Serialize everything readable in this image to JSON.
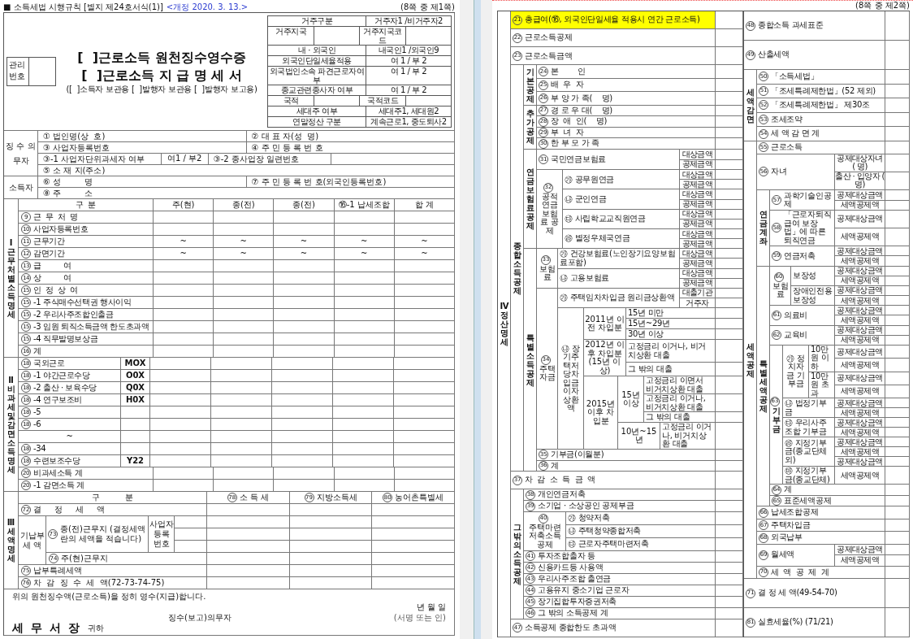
{
  "left_page": {
    "form_id": "■ 소득세법 시행규칙 [별지 제24호서식(1)]",
    "revision": "<개정 2020. 3. 13.>",
    "page_no": "(8쪽 중 제1쪽)",
    "management_label": "관리번호",
    "titles": [
      "[  ]근로소득 원천징수영수증",
      "[  ]근로소득 지 급 명 세 서"
    ],
    "copies": "([  ]소득자 보관용 [  ]발행자 보관용 [  ]발행자 보고용)",
    "info_rows": [
      {
        "kind": "pair",
        "cells": [
          "거주구분",
          "거주자1 /비거주자2"
        ]
      },
      {
        "kind": "blanks",
        "cells": [
          "거주지국",
          "거주지국코드"
        ]
      },
      {
        "kind": "pair",
        "cells": [
          "내 · 외국인",
          "내국인1 /외국인9"
        ]
      },
      {
        "kind": "pair",
        "cells": [
          "외국인단일세율적용",
          "여 1 / 부 2"
        ]
      },
      {
        "kind": "pair",
        "cells": [
          "외국법인소속 파견근로자여부",
          "여 1 / 부 2"
        ]
      },
      {
        "kind": "pair",
        "cells": [
          "종교관련종사자 여부",
          "여 1 / 부 2"
        ]
      },
      {
        "kind": "blanks",
        "cells": [
          "국적",
          "국적코드"
        ]
      },
      {
        "kind": "pair",
        "cells": [
          "세대주 여부",
          "세대주1, 세대원2"
        ]
      },
      {
        "kind": "pair",
        "cells": [
          "연말정산 구분",
          "계속근로1, 중도퇴사2"
        ]
      }
    ],
    "parties": [
      {
        "label": "징 수 의무자",
        "rows": [
          [
            {
              "kind": "label",
              "text": "① 법인명(상  호)"
            },
            {
              "kind": "label",
              "text": "② 대 표 자(성  명)"
            }
          ],
          [
            {
              "kind": "label",
              "text": "③ 사업자등록번호"
            },
            {
              "kind": "label",
              "text": "④ 주 민 등 록 번 호"
            }
          ],
          [
            {
              "kind": "label",
              "text": "③-1 사업자단위과세자 여부"
            },
            {
              "kind": "option",
              "text": "여1 / 부2"
            },
            {
              "kind": "label",
              "text": "③-2 종사업장 일련번호"
            }
          ],
          [
            {
              "kind": "label",
              "text": "⑤ 소 재 지(주소)"
            }
          ]
        ]
      },
      {
        "label": "소득자",
        "rows": [
          [
            {
              "kind": "label",
              "text": "⑥ 성         명"
            },
            {
              "kind": "label",
              "text": "⑦ 주 민 등 록 번 호(외국인등록번호)"
            }
          ],
          [
            {
              "kind": "label",
              "text": "⑧ 주         소"
            }
          ]
        ]
      }
    ],
    "income": {
      "side": "Ⅰ근무처별소득명세",
      "columns": [
        "구  분",
        "주(현)",
        "종(전)",
        "종(전)",
        "⑯-1 납세조합",
        "합  계"
      ],
      "rows": [
        {
          "num": "9",
          "label": "근  무  처  명"
        },
        {
          "num": "10",
          "label": "사업자등록번호"
        },
        {
          "num": "11",
          "label": "근무기간",
          "cells": [
            "~",
            "~",
            "~",
            "~",
            "~"
          ]
        },
        {
          "num": "12",
          "label": "감면기간",
          "cells": [
            "~",
            "~",
            "~",
            "~",
            "~"
          ]
        },
        {
          "num": "13",
          "label": "급          여"
        },
        {
          "num": "14",
          "label": "상          여"
        },
        {
          "num": "15",
          "label": "인  정  상  여"
        },
        {
          "num": "15",
          "label": "-1 주식매수선택권 행사이익"
        },
        {
          "num": "15",
          "label": "-2 우리사주조합인출금"
        },
        {
          "num": "15",
          "label": "-3 임원 퇴직소득금액 한도초과액"
        },
        {
          "num": "15",
          "label": "-4 직무발명보상금"
        },
        {
          "num": "16",
          "label": "계"
        }
      ]
    },
    "nontax": {
      "side": "Ⅱ비과세및감면소득명세",
      "rows": [
        {
          "kind": "item",
          "num": "18",
          "label": "국외근로",
          "code": "MOX"
        },
        {
          "kind": "item",
          "num": "18",
          "label": "-1 야간근로수당",
          "code": "O0X"
        },
        {
          "kind": "item",
          "num": "18",
          "label": "-2 출산 · 보육수당",
          "code": "Q0X"
        },
        {
          "kind": "item",
          "num": "18",
          "label": "-4 연구보조비",
          "code": "H0X"
        },
        {
          "kind": "item",
          "num": "18",
          "label": "-5"
        },
        {
          "kind": "item",
          "num": "18",
          "label": "-6"
        },
        {
          "kind": "ellipsis",
          "label": "~"
        },
        {
          "kind": "item",
          "num": "18",
          "label": "-34"
        },
        {
          "kind": "item",
          "num": "18",
          "label": "수련보조수당",
          "code": "Y22"
        },
        {
          "kind": "total",
          "num": "20",
          "label": "비과세소득 계"
        },
        {
          "kind": "total",
          "num": "20",
          "label": "-1 감면소득 계"
        }
      ]
    },
    "tax": {
      "side": "Ⅲ세액명세",
      "heading": "구          분",
      "columns": [
        {
          "num": "78",
          "label": "소   득   세"
        },
        {
          "num": "79",
          "label": "지방소득세"
        },
        {
          "num": "80",
          "label": "농어촌특별세"
        }
      ],
      "determined": {
        "num": "72",
        "label": "결     정     세     액"
      },
      "prepaid": "기납부 세  액",
      "previous": {
        "num": "73",
        "label": "종(전)근무지 (결정세액란의 세액을 적습니다)"
      },
      "business_no": "사업자 등록 번호",
      "current": {
        "num": "74",
        "label": "주(현)근무지"
      },
      "special": {
        "num": "75",
        "label": "납부특례세액"
      },
      "collect": {
        "num": "76",
        "label": "차  감  징  수  세  액(72-73-74-75)"
      }
    },
    "footer": {
      "statement": "위의 원천징수액(근로소득)을 정히 영수(지급)합니다.",
      "date": "년    월    일",
      "obligor": "징수(보고)의무자",
      "sign": "(서명 또는 인)",
      "office": "세 무 서 장",
      "honorific": "귀하"
    }
  },
  "right_page": {
    "page_no": "(8쪽 중 제2쪽)",
    "section": "Ⅳ정산명세",
    "left_tree": [
      {
        "num": "21",
        "label": "총급여(⑯, 외국인단일세율 적용시 연간 근로소득)",
        "highlighted": true
      },
      {
        "num": "22",
        "label": "근로소득공제",
        "highlighted": false
      },
      {
        "num": "23",
        "label": "근로소득금액",
        "highlighted": false
      },
      {
        "label": "종합소득공제",
        "vertical": true,
        "children": [
          {
            "label": "기본공제",
            "vertical": true,
            "children": [
              {
                "num": "24",
                "label": "본        인"
              },
              {
                "num": "25",
                "label": "배  우  자"
              },
              {
                "num": "26",
                "label": "부 양 가 족(    명)"
              }
            ]
          },
          {
            "label": "추가공제",
            "vertical": true,
            "children": [
              {
                "num": "27",
                "label": "경 로 우 대(    명)"
              },
              {
                "num": "28",
                "label": "장  애  인(    명)"
              },
              {
                "num": "29",
                "label": "부  녀  자"
              },
              {
                "num": "30",
                "label": "한 부 모 가 족"
              }
            ]
          },
          {
            "label": "연금보험료공제",
            "vertical": true,
            "children": [
              {
                "num": "31",
                "label": "국민연금보험료",
                "subs": [
                  "대상금액",
                  "공제금액"
                ]
              },
              {
                "num": "32",
                "label": "공적연금 보험료 공제",
                "children": [
                  {
                    "label": "㉮ 공무원연금",
                    "subs": [
                      "대상금액",
                      "공제금액"
                    ]
                  },
                  {
                    "label": "㉯ 군인연금",
                    "subs": [
                      "대상금액",
                      "공제금액"
                    ]
                  },
                  {
                    "label": "㉰ 사립학교교직원연금",
                    "subs": [
                      "대상금액",
                      "공제금액"
                    ]
                  },
                  {
                    "label": "㉱ 별정우체국연금",
                    "subs": [
                      "대상금액",
                      "공제금액"
                    ]
                  }
                ]
              }
            ]
          },
          {
            "label": "특별소득공제",
            "vertical": true,
            "children": [
              {
                "num": "33",
                "label": "보험료",
                "children": [
                  {
                    "label": "㉮ 건강보험료(노인장기요양보험료포함)",
                    "subs": [
                      "대상금액",
                      "공제금액"
                    ]
                  },
                  {
                    "label": "㉯ 고용보험료",
                    "subs": [
                      "대상금액",
                      "공제금액"
                    ]
                  }
                ]
              },
              {
                "num": "34",
                "label": "주택자금",
                "children": [
                  {
                    "label": "㉮ 주택임차차입금 원리금상환액",
                    "subs": [
                      "대출기관",
                      "거주자"
                    ]
                  },
                  {
                    "label": "㉯ 장기주택저당차입금이자상환액",
                    "children": [
                      {
                        "label": "2011년 이전 차입분",
                        "children": [
                          {
                            "label": "15년 미만"
                          },
                          {
                            "label": "15년~29년"
                          },
                          {
                            "label": "30년 이상"
                          }
                        ]
                      },
                      {
                        "label": "2012년 이후 차입분(15년 이상)",
                        "children": [
                          {
                            "label": "고정금리 이거나, 비거치상환 대출"
                          },
                          {
                            "label": "그 밖의 대출"
                          }
                        ]
                      },
                      {
                        "label": "2015년 이후 차입분",
                        "children": [
                          {
                            "label": "15년 이상",
                            "children": [
                              {
                                "label": "고정금리 이면서 비거치상환 대출"
                              },
                              {
                                "label": "고정금리 이거나, 비거치상환 대출"
                              },
                              {
                                "label": "그 밖의 대출"
                              }
                            ]
                          },
                          {
                            "label": "10년~15년",
                            "children": [
                              {
                                "label": "고정금리 이거나, 비거치상환 대출"
                              }
                            ]
                          }
                        ]
                      }
                    ]
                  }
                ]
              },
              {
                "num": "35",
                "label": "기부금(이월분)"
              },
              {
                "num": "36",
                "label": "계"
              }
            ]
          }
        ]
      },
      {
        "num": "37",
        "label": "차  감  소  득  금  액",
        "highlighted": false
      },
      {
        "label": "그밖의소득공제",
        "vertical": true,
        "children": [
          {
            "num": "38",
            "label": "개인연금저축"
          },
          {
            "num": "39",
            "label": "소기업 · 소상공인 공제부금"
          },
          {
            "num": "40",
            "label": "주택마련저축소득공제",
            "children": [
              {
                "label": "㉮ 청약저축"
              },
              {
                "label": "㉯ 주택청약종합저축"
              },
              {
                "label": "㉰ 근로자주택마련저축"
              }
            ]
          },
          {
            "num": "41",
            "label": "투자조합출자 등"
          },
          {
            "num": "42",
            "label": "신용카드등 사용액"
          },
          {
            "num": "43",
            "label": "우리사주조합 출연금"
          },
          {
            "num": "44",
            "label": "고용유지 중소기업 근로자"
          },
          {
            "num": "45",
            "label": "장기집합투자증권저축"
          },
          {
            "num": "46",
            "label": "그 밖의 소득공제 계"
          }
        ]
      },
      {
        "num": "47",
        "label": "소득공제 종합한도 초과액",
        "highlighted": false
      }
    ],
    "right_tree": [
      {
        "num": "48",
        "label": "종합소득 과세표준"
      },
      {
        "num": "49",
        "label": "산출세액"
      },
      {
        "label": "세액감면",
        "vertical": true,
        "children": [
          {
            "num": "50",
            "label": "「소득세법」"
          },
          {
            "num": "51",
            "label": "「조세특례제한법」(52 제외)"
          },
          {
            "num": "52",
            "label": "「조세특례제한법」 제30조"
          },
          {
            "num": "53",
            "label": "조세조약"
          },
          {
            "num": "54",
            "label": "세 액 감 면 계"
          }
        ]
      },
      {
        "label": "세액공제",
        "vertical": true,
        "children": [
          {
            "num": "55",
            "label": "근로소득"
          },
          {
            "num": "56",
            "label": "자녀",
            "subs": [
              "공제대상자녀 (  명)",
              "출산 · 입양자 (  명)"
            ]
          },
          {
            "label": "연금계좌",
            "vertical": true,
            "children": [
              {
                "num": "57",
                "label": "과학기술인공제",
                "subs": [
                  "공제대상금액",
                  "세액공제액"
                ]
              },
              {
                "num": "58",
                "label": "「근로자퇴직급여 보장법」에 따른 퇴직연금",
                "subs": [
                  "공제대상금액",
                  "세액공제액"
                ]
              },
              {
                "num": "59",
                "label": "연금저축",
                "subs": [
                  "공제대상금액",
                  "세액공제액"
                ]
              }
            ]
          },
          {
            "label": "특별세액공제",
            "vertical": true,
            "children": [
              {
                "num": "60",
                "label": "보험료",
                "children": [
                  {
                    "label": "보장성",
                    "subs": [
                      "공제대상금액",
                      "세액공제액"
                    ]
                  },
                  {
                    "label": "장애인전용 보장성",
                    "subs": [
                      "공제대상금액",
                      "세액공제액"
                    ]
                  }
                ]
              },
              {
                "num": "61",
                "label": "의료비",
                "subs": [
                  "공제대상금액",
                  "세액공제액"
                ]
              },
              {
                "num": "62",
                "label": "교육비",
                "subs": [
                  "공제대상금액",
                  "세액공제액"
                ]
              },
              {
                "num": "63",
                "label": "기부금",
                "vertical": true,
                "children": [
                  {
                    "label": "㉮ 정치자금 기부금",
                    "children": [
                      {
                        "label": "10만원 이하",
                        "subs": [
                          "공제대상금액",
                          "세액공제액"
                        ]
                      },
                      {
                        "label": "10만원 초과",
                        "subs": [
                          "공제대상금액",
                          "세액공제액"
                        ]
                      }
                    ]
                  },
                  {
                    "label": "㉯ 법정기부금",
                    "subs": [
                      "공제대상금액",
                      "세액공제액"
                    ]
                  },
                  {
                    "label": "㉰ 우리사주조합 기부금",
                    "subs": [
                      "공제대상금액",
                      "세액공제액"
                    ]
                  },
                  {
                    "label": "㉱ 지정기부금(종교단체외)",
                    "subs": [
                      "공제대상금액",
                      "세액공제액",
                      "공제대상금액"
                    ]
                  },
                  {
                    "label": "㉲ 지정기부금(종교단체)",
                    "subs": [
                      "세액공제액"
                    ]
                  }
                ]
              },
              {
                "num": "64",
                "label": "계"
              },
              {
                "num": "65",
                "label": "표준세액공제"
              }
            ]
          },
          {
            "num": "66",
            "label": "납세조합공제"
          },
          {
            "num": "67",
            "label": "주택차입금"
          },
          {
            "num": "68",
            "label": "외국납부"
          },
          {
            "num": "69",
            "label": "월세액",
            "subs": [
              "공제대상금액",
              "세액공제액"
            ]
          },
          {
            "num": "70",
            "label": "세  액  공  제  계"
          }
        ]
      },
      {
        "num": "71",
        "label": "결 정 세 액(49-54-70)"
      },
      {
        "num": "81",
        "label": "실효세율(%) (71/21)"
      }
    ]
  }
}
